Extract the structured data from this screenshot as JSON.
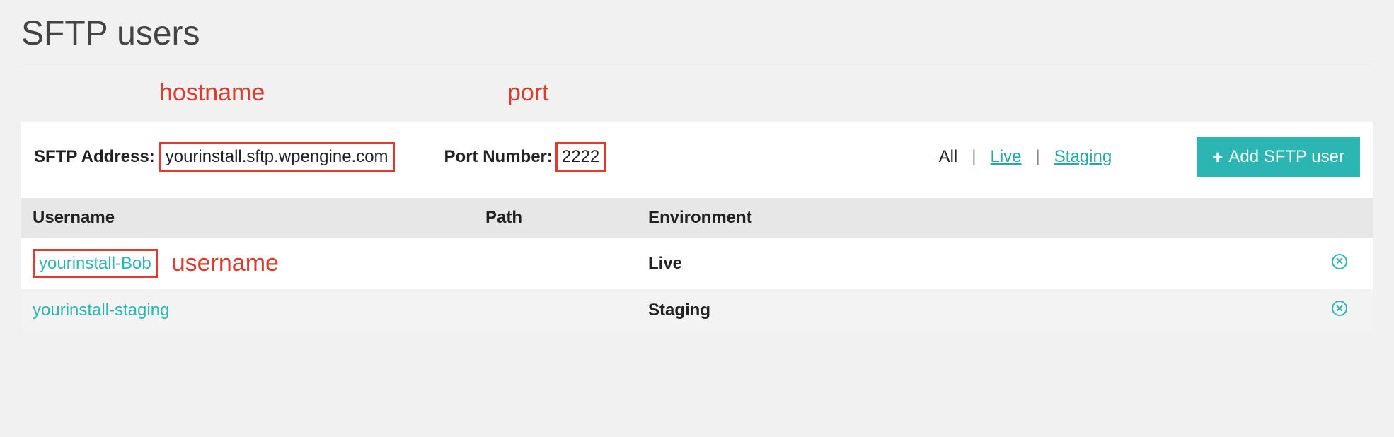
{
  "page": {
    "title": "SFTP users"
  },
  "annotations": {
    "hostname_label": "hostname",
    "port_label": "port",
    "username_label": "username"
  },
  "connection": {
    "address_label": "SFTP Address:",
    "address_value": "yourinstall.sftp.wpengine.com",
    "port_label": "Port Number:",
    "port_value": "2222"
  },
  "filters": {
    "all": "All",
    "live": "Live",
    "staging": "Staging",
    "separator": "|"
  },
  "actions": {
    "add_button": "Add SFTP user"
  },
  "table": {
    "headers": {
      "username": "Username",
      "path": "Path",
      "environment": "Environment"
    },
    "rows": [
      {
        "username": "yourinstall-Bob",
        "path": "",
        "environment": "Live",
        "highlighted": true
      },
      {
        "username": "yourinstall-staging",
        "path": "",
        "environment": "Staging",
        "highlighted": false
      }
    ]
  },
  "colors": {
    "accent": "#2bb6b4",
    "annotation": "#dc3b2e"
  }
}
